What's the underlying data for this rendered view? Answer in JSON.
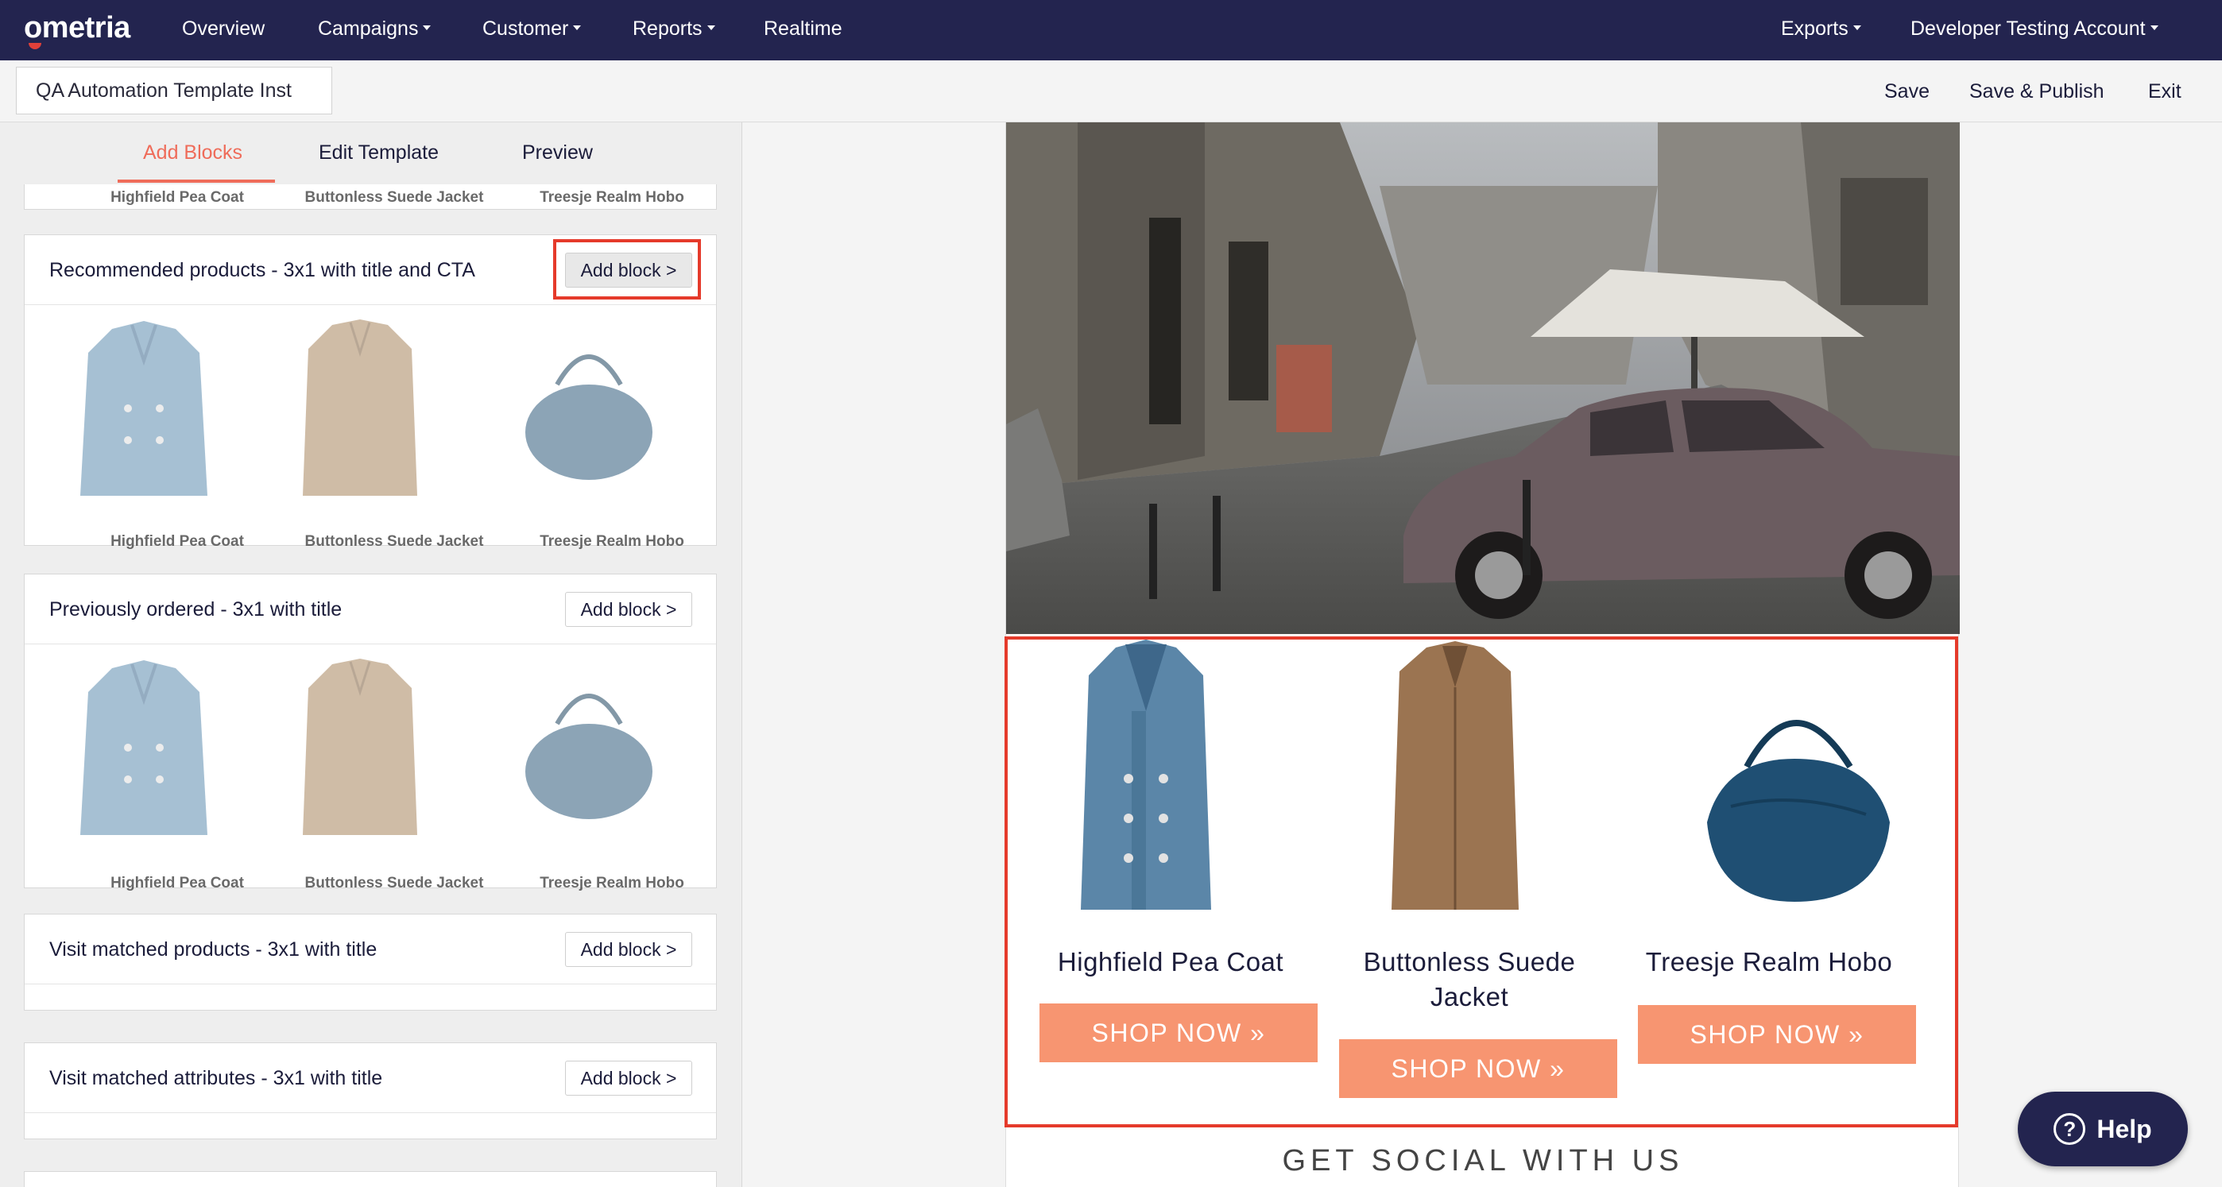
{
  "brand": {
    "logo_text": "ometria"
  },
  "nav": {
    "items": [
      {
        "label": "Overview",
        "dropdown": false
      },
      {
        "label": "Campaigns",
        "dropdown": true
      },
      {
        "label": "Customer",
        "dropdown": true
      },
      {
        "label": "Reports",
        "dropdown": true
      },
      {
        "label": "Realtime",
        "dropdown": false
      }
    ],
    "exports_label": "Exports",
    "account_label": "Developer Testing Account"
  },
  "toolbar": {
    "template_name_value": "QA Automation Template Inst",
    "save_label": "Save",
    "save_publish_label": "Save & Publish",
    "exit_label": "Exit"
  },
  "left_panel": {
    "tabs": [
      {
        "label": "Add Blocks",
        "active": true
      },
      {
        "label": "Edit Template",
        "active": false
      },
      {
        "label": "Preview",
        "active": false
      }
    ],
    "product_captions": [
      "Highfield Pea Coat",
      "Buttonless Suede Jacket",
      "Treesje Realm Hobo"
    ],
    "blocks": [
      {
        "title": "Recommended products - 3x1 with title and CTA",
        "button": "Add block >",
        "highlighted": true
      },
      {
        "title": "Previously ordered - 3x1 with title",
        "button": "Add block >",
        "highlighted": false
      },
      {
        "title": "Visit matched products - 3x1 with title",
        "button": "Add block >",
        "highlighted": false
      },
      {
        "title": "Visit matched attributes - 3x1 with title",
        "button": "Add block >",
        "highlighted": false
      }
    ]
  },
  "email_preview": {
    "products": [
      {
        "name": "Highfield Pea Coat",
        "cta": "SHOP NOW »"
      },
      {
        "name": "Buttonless Suede Jacket",
        "cta": "SHOP NOW »"
      },
      {
        "name": "Treesje Realm Hobo",
        "cta": "SHOP NOW »"
      }
    ],
    "social_heading": "GET SOCIAL WITH US"
  },
  "help": {
    "label": "Help",
    "icon": "question-icon"
  },
  "colors": {
    "nav_bg": "#23244f",
    "accent": "#ef6c5a",
    "cta": "#f79571",
    "highlight": "#e53a2b"
  }
}
